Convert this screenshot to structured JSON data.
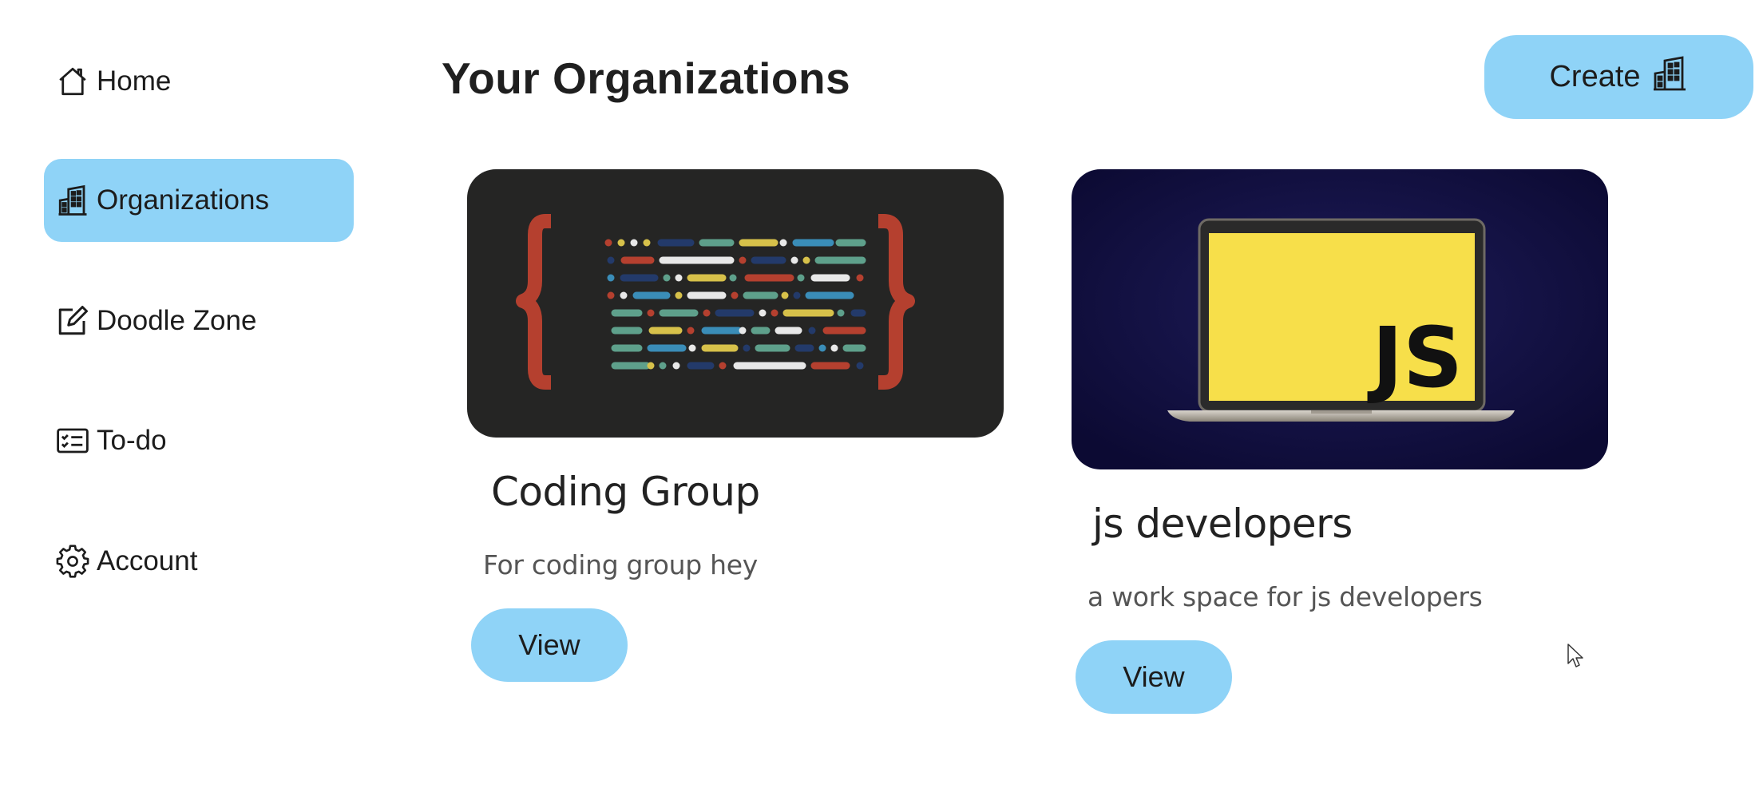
{
  "sidebar": {
    "items": [
      {
        "label": "Home",
        "icon": "home-icon",
        "active": false
      },
      {
        "label": "Organizations",
        "icon": "building-icon",
        "active": true
      },
      {
        "label": "Doodle Zone",
        "icon": "edit-icon",
        "active": false
      },
      {
        "label": "To-do",
        "icon": "checklist-icon",
        "active": false
      },
      {
        "label": "Account",
        "icon": "gear-icon",
        "active": false
      }
    ]
  },
  "header": {
    "title": "Your Organizations",
    "create_label": "Create",
    "create_icon": "building-icon"
  },
  "organizations": [
    {
      "name": "Coding Group",
      "description": "For coding group hey",
      "view_label": "View",
      "image_icon": "code-braces-image"
    },
    {
      "name": "js developers",
      "description": "a work space for js developers",
      "view_label": "View",
      "image_icon": "js-laptop-image",
      "image_text": "JS"
    }
  ],
  "colors": {
    "accent": "#8fd3f7",
    "card1_bg": "#252524",
    "card2_bg": "#0f0d3a",
    "js_yellow": "#f7df4a",
    "brace_red": "#b5402f"
  }
}
